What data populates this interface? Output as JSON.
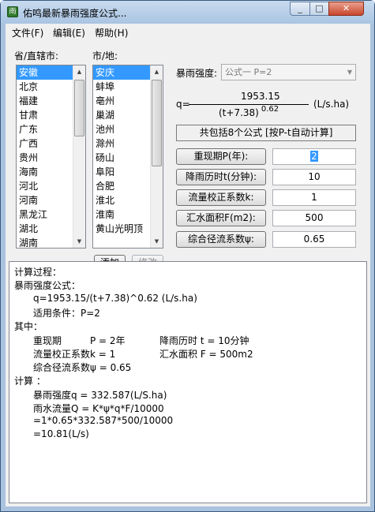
{
  "window": {
    "title": "佑鸣最新暴雨强度公式...",
    "min_icon": "_",
    "max_icon": "□",
    "close_icon": "✕",
    "app_icon": "app-icon"
  },
  "menu": {
    "file": "文件(F)",
    "edit": "编辑(E)",
    "help": "帮助(H)"
  },
  "province": {
    "label": "省/直辖市:",
    "items": [
      "安徽",
      "北京",
      "福建",
      "甘肃",
      "广东",
      "广西",
      "贵州",
      "海南",
      "河北",
      "河南",
      "黑龙江",
      "湖北",
      "湖南"
    ],
    "selected_index": 0
  },
  "city": {
    "label": "市/地:",
    "items": [
      "安庆",
      "蚌埠",
      "亳州",
      "巢湖",
      "池州",
      "滁州",
      "砀山",
      "阜阳",
      "合肥",
      "淮北",
      "淮南",
      "黄山光明顶"
    ],
    "selected_index": 0
  },
  "buttons": {
    "add": "添加",
    "modify": "修改"
  },
  "formula": {
    "label": "暴雨强度:",
    "selected": "公式一 P=2",
    "q_label": "q=",
    "numerator": "1953.15",
    "denominator": "(t+7.38)",
    "exponent": "0.62",
    "unit": "(L/s.ha)",
    "count_info": "共包括8个公式 [按P-t自动计算]"
  },
  "params": [
    {
      "label": "重现期P(年):",
      "value": "2"
    },
    {
      "label": "降雨历时t(分钟):",
      "value": "10"
    },
    {
      "label": "流量校正系数k:",
      "value": "1"
    },
    {
      "label": "汇水面积F(m2):",
      "value": "500"
    },
    {
      "label": "综合径流系数ψ:",
      "value": "0.65"
    }
  ],
  "process": {
    "lines": [
      "计算过程：",
      "暴雨强度公式：",
      "q=1953.15/(t+7.38)^0.62 (L/s.ha)",
      "适用条件：P=2",
      "其中：",
      "重现期",
      "P = 2年",
      "降雨历时 t = 10分钟",
      "流量校正系数k = 1",
      "汇水面积 F = 500m2",
      "综合径流系数ψ = 0.65",
      "计算 ：",
      "暴雨强度q = 332.587(L/S.ha)",
      "雨水流量Q = K*ψ*q*F/10000",
      "=1*0.65*332.587*500/10000",
      "=10.81(L/s)"
    ]
  }
}
